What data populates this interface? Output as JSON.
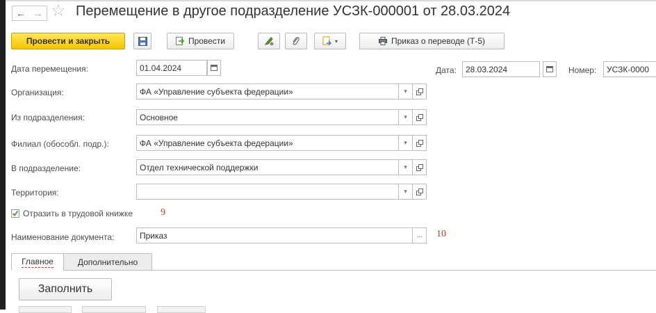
{
  "window": {
    "title": "Перемещение в другое подразделение УСЗК-000001 от 28.03.2024",
    "back_glyph": "←",
    "forward_glyph": "→",
    "favorite_glyph": "☆"
  },
  "toolbar": {
    "post_and_close_label": "Провести и закрыть",
    "post_label": "Провести",
    "print_order_label": "Приказ о переводе (Т-5)"
  },
  "header": {
    "date_label": "Дата:",
    "date_value": "28.03.2024",
    "number_label": "Номер:",
    "number_value": "УСЗК-0000"
  },
  "form": {
    "transfer_date_label": "Дата перемещения:",
    "transfer_date_value": "01.04.2024",
    "organization_label": "Организация:",
    "organization_value": "ФА «Управление субъекта федерации»",
    "from_department_label": "Из подразделения:",
    "from_department_value": "Основное",
    "branch_label": "Филиал (обособл. подр.):",
    "branch_value": "ФА «Управление субъекта федерации»",
    "to_department_label": "В подразделение:",
    "to_department_value": "Отдел технической поддержки",
    "territory_label": "Территория:",
    "territory_value": "",
    "workbook_checkbox_label": "Отразить в трудовой книжке",
    "workbook_checked": true,
    "doc_name_label": "Наименование документа:",
    "doc_name_value": "Приказ",
    "ellipsis": "...",
    "mark_9": "9",
    "mark_10": "10"
  },
  "tabs": {
    "main_label": "Главное",
    "additional_label": "Дополнительно"
  },
  "main_tab": {
    "fill_button_label": "Заполнить"
  },
  "colors": {
    "primary_button": "#f5c800",
    "annotation_red": "#c0392b",
    "check_green": "#3a9d23"
  },
  "icons": [
    "back-arrow-icon",
    "forward-arrow-icon",
    "favorite-star-icon",
    "save-icon",
    "post-icon",
    "edit-icon",
    "attach-icon",
    "create-based-on-icon",
    "print-icon",
    "calendar-icon",
    "dropdown-icon",
    "open-icon",
    "checkbox-icon"
  ]
}
